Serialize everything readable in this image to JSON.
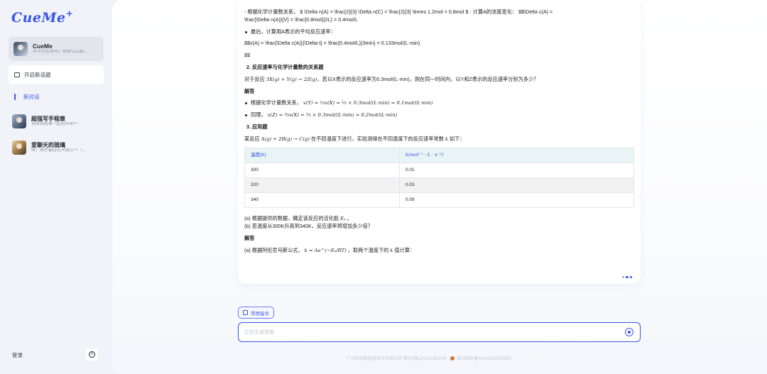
{
  "sidebar": {
    "logo": "CueMe",
    "logo_plus": "+",
    "agent": {
      "name": "CueMe",
      "subtitle": "有写作任务吗？快来试试我..."
    },
    "new_topic_label": "开启新话题",
    "new_chat_label": "新对话",
    "conversations": [
      {
        "title": "超强写手程章",
        "subtitle": "快来找程章一起创作吧～"
      },
      {
        "title": "爱聊天的琉璃",
        "subtitle": "嘿？刚才最@在叫我么～（..."
      }
    ],
    "login_label": "登录",
    "info_icon": "i"
  },
  "message": {
    "line1": "- 根据化学计量数关系， $ \\Delta n(A) = \\frac{2}{3} \\Delta n(C) = \\frac{2}{3} \\times 1.2mol = 0.8mol $ - 计算A的浓度变化： $$\\Delta c(A) =",
    "line2": "\\frac{\\Delta n(A)}{V} = \\frac{0.8mol}{2L} = 0.4mol/L",
    "bullet_last": "最后，计算用A表示的平均反应速率：",
    "formula": "$$v(A) = \\frac{\\Delta c(A)}{\\Delta t} = \\frac{0.4mol/L}{3min} = 0.133mol/(L·min)",
    "formula_end": "$$",
    "section2": "2. 反应速率与化学计量数的关系题",
    "q2_prefix": "对于反应",
    "q2_eq": "3X(g) + Y(g) → 2Z(g)",
    "q2_suffix": "，若以X表示的反应速率为0.3mol/(L·min)，则在同一时间内，以Y和Z表示的反应速率分别为多少？",
    "answer_label": "解答",
    "a2_b1_prefix": "根据化学计量数关系，",
    "a2_b1_eq": "v(Y) = ⅓v(X) = ⅓ × 0.3mol/(L·min) = 0.1mol/(L·min)",
    "a2_b2_prefix": "同理，",
    "a2_b2_eq": "v(Z) = ⅔v(X) = ⅔ × 0.3mol/(L·min) = 0.2mol/(L·min)",
    "section3": "3. 应用题",
    "q3_prefix": "某反应",
    "q3_eq": "A(g) + 2B(g) → C(g)",
    "q3_mid": "在不同温度下进行，实验测得在不同温度下的反应速率常数",
    "q3_k": "k",
    "q3_suffix": "如下：",
    "table": {
      "headers": [
        "温度(K)",
        "k(mol⁻¹ · L · s⁻¹)"
      ],
      "rows": [
        [
          "300",
          "0.01"
        ],
        [
          "320",
          "0.03"
        ],
        [
          "340",
          "0.09"
        ]
      ]
    },
    "qa_prefix": "(a) 根据提供的数据，确定该反应的活化能",
    "qa_eq": "Eₐ",
    "qa_suffix": "。",
    "qb": "(b) 若温度从300K升高到340K，反应速率将增加多少倍？",
    "answer_label2": "解答",
    "aa_prefix": "(a) 根据阿伦尼乌斯公式，",
    "aa_eq": "k = Ae^(−Eₐ/RT)",
    "aa_mid": "，取两个温度下的",
    "aa_k": "k",
    "aa_suffix": "值计算："
  },
  "composer": {
    "commands_label": "常用指令",
    "input_placeholder": "正在生成答案",
    "input_value": ""
  },
  "footer": {
    "icp": "广州市动能智慧技术有限公司 粤ICP备2022013084号",
    "police": "粤公网安备44010502003055"
  },
  "colors": {
    "accent": "#3a55e6",
    "table_header": "#e9f4f7"
  }
}
